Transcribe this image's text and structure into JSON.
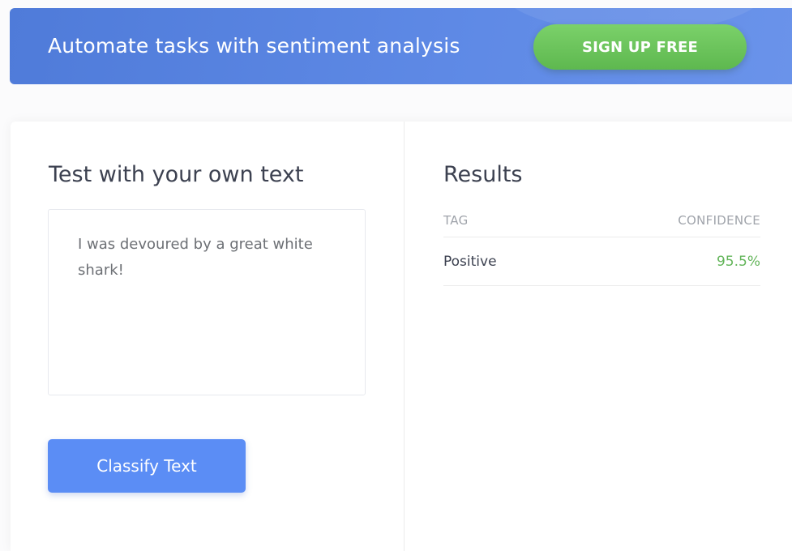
{
  "banner": {
    "text": "Automate tasks with sentiment analysis",
    "cta_label": "SIGN UP FREE"
  },
  "input_panel": {
    "title": "Test with your own text",
    "text_value": "I was devoured by a great white shark!",
    "button_label": "Classify Text"
  },
  "results_panel": {
    "title": "Results",
    "columns": [
      "TAG",
      "CONFIDENCE"
    ],
    "rows": [
      {
        "tag": "Positive",
        "confidence": "95.5%"
      }
    ]
  },
  "colors": {
    "banner": "#5a86e2",
    "cta": "#6cc55c",
    "primary_button": "#5b8df5",
    "confidence_text": "#63b55a"
  }
}
